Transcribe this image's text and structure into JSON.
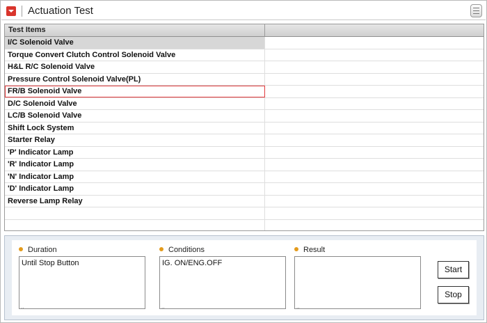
{
  "window": {
    "title": "Actuation Test",
    "title_icon": "dropdown-arrow-icon",
    "menu_icon": "list-menu-icon"
  },
  "table": {
    "columns": [
      "Test Items",
      ""
    ],
    "rows": [
      {
        "label": "I/C Solenoid Valve",
        "state": "selected"
      },
      {
        "label": "Torque Convert Clutch Control Solenoid Valve",
        "state": ""
      },
      {
        "label": "H&L R/C Solenoid Valve",
        "state": ""
      },
      {
        "label": "Pressure Control Solenoid Valve(PL)",
        "state": ""
      },
      {
        "label": "FR/B Solenoid Valve",
        "state": "focused"
      },
      {
        "label": "D/C Solenoid Valve",
        "state": ""
      },
      {
        "label": "LC/B Solenoid Valve",
        "state": ""
      },
      {
        "label": "Shift Lock System",
        "state": ""
      },
      {
        "label": "Starter Relay",
        "state": ""
      },
      {
        "label": "'P' Indicator Lamp",
        "state": ""
      },
      {
        "label": "'R' Indicator Lamp",
        "state": ""
      },
      {
        "label": "'N' Indicator Lamp",
        "state": ""
      },
      {
        "label": "'D' Indicator Lamp",
        "state": ""
      },
      {
        "label": "Reverse Lamp Relay",
        "state": ""
      },
      {
        "label": "",
        "state": ""
      },
      {
        "label": "",
        "state": ""
      }
    ]
  },
  "panel": {
    "duration": {
      "label": "Duration",
      "value": "Until Stop Button"
    },
    "conditions": {
      "label": "Conditions",
      "value": "IG. ON/ENG.OFF"
    },
    "result": {
      "label": "Result",
      "value": ""
    },
    "start_label": "Start",
    "stop_label": "Stop"
  },
  "colors": {
    "accent_red": "#d9352c",
    "bullet_orange": "#e49b1c",
    "selected_row": "#d7d7d7",
    "focus_outline": "#e0393b",
    "panel_bg": "#e8edf3"
  }
}
